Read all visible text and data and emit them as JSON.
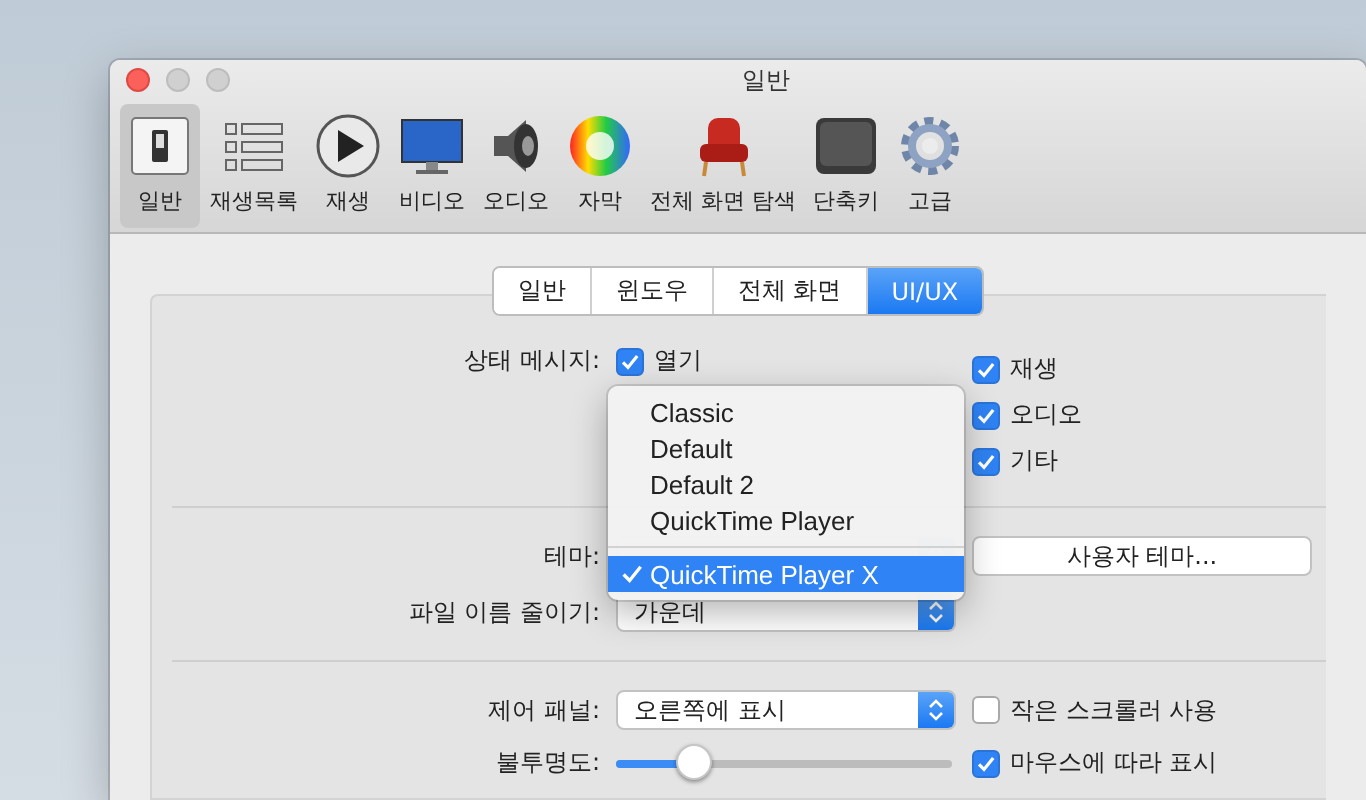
{
  "window": {
    "title": "일반"
  },
  "toolbar": [
    {
      "kind": "switch",
      "label": "일반",
      "selected": true
    },
    {
      "kind": "list",
      "label": "재생목록",
      "selected": false
    },
    {
      "kind": "play",
      "label": "재생",
      "selected": false
    },
    {
      "kind": "monitor",
      "label": "비디오",
      "selected": false
    },
    {
      "kind": "speaker",
      "label": "오디오",
      "selected": false
    },
    {
      "kind": "colorwheel",
      "label": "자막",
      "selected": false
    },
    {
      "kind": "chair",
      "label": "전체 화면 탐색",
      "selected": false
    },
    {
      "kind": "key",
      "label": "단축키",
      "selected": false
    },
    {
      "kind": "gear",
      "label": "고급",
      "selected": false
    }
  ],
  "tabs": [
    {
      "label": "일반",
      "selected": false
    },
    {
      "label": "윈도우",
      "selected": false
    },
    {
      "label": "전체 화면",
      "selected": false
    },
    {
      "label": "UI/UX",
      "selected": true
    }
  ],
  "status_messages": {
    "label": "상태 메시지:",
    "left_options": [
      {
        "label": "열기",
        "checked": true
      }
    ],
    "right_options": [
      {
        "label": "재생",
        "checked": true
      },
      {
        "label": "오디오",
        "checked": true
      },
      {
        "label": "기타",
        "checked": true
      }
    ]
  },
  "theme": {
    "label": "테마:",
    "button": "사용자 테마...",
    "menu": [
      {
        "label": "Classic",
        "selected": false
      },
      {
        "label": "Default",
        "selected": false
      },
      {
        "label": "Default 2",
        "selected": false
      },
      {
        "label": "QuickTime Player",
        "selected": false
      },
      {
        "label": "QuickTime Player X",
        "selected": true
      }
    ]
  },
  "filename": {
    "label": "파일 이름 줄이기:",
    "value": "가운데"
  },
  "control_panel": {
    "label": "제어 패널:",
    "value": "오른쪽에 표시",
    "option": {
      "label": "작은 스크롤러 사용",
      "checked": false
    }
  },
  "opacity": {
    "label": "불투명도:",
    "level": 0.23,
    "option": {
      "label": "마우스에 따라 표시",
      "checked": true
    }
  }
}
